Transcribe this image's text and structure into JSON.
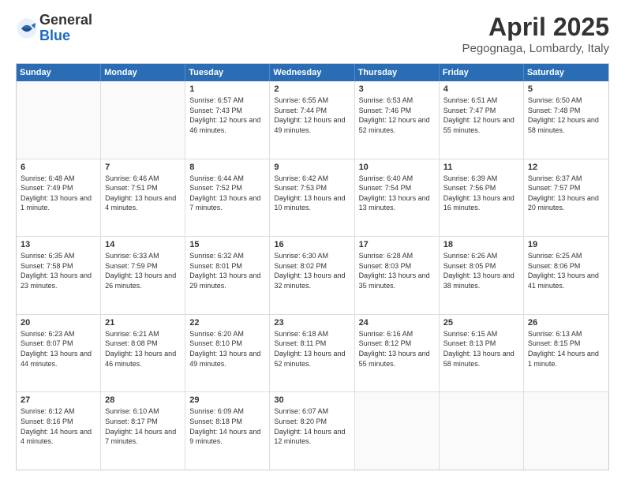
{
  "header": {
    "logo_general": "General",
    "logo_blue": "Blue",
    "title": "April 2025",
    "location": "Pegognaga, Lombardy, Italy"
  },
  "weekdays": [
    "Sunday",
    "Monday",
    "Tuesday",
    "Wednesday",
    "Thursday",
    "Friday",
    "Saturday"
  ],
  "rows": [
    [
      {
        "day": "",
        "detail": ""
      },
      {
        "day": "",
        "detail": ""
      },
      {
        "day": "1",
        "detail": "Sunrise: 6:57 AM\nSunset: 7:43 PM\nDaylight: 12 hours\nand 46 minutes."
      },
      {
        "day": "2",
        "detail": "Sunrise: 6:55 AM\nSunset: 7:44 PM\nDaylight: 12 hours\nand 49 minutes."
      },
      {
        "day": "3",
        "detail": "Sunrise: 6:53 AM\nSunset: 7:46 PM\nDaylight: 12 hours\nand 52 minutes."
      },
      {
        "day": "4",
        "detail": "Sunrise: 6:51 AM\nSunset: 7:47 PM\nDaylight: 12 hours\nand 55 minutes."
      },
      {
        "day": "5",
        "detail": "Sunrise: 6:50 AM\nSunset: 7:48 PM\nDaylight: 12 hours\nand 58 minutes."
      }
    ],
    [
      {
        "day": "6",
        "detail": "Sunrise: 6:48 AM\nSunset: 7:49 PM\nDaylight: 13 hours\nand 1 minute."
      },
      {
        "day": "7",
        "detail": "Sunrise: 6:46 AM\nSunset: 7:51 PM\nDaylight: 13 hours\nand 4 minutes."
      },
      {
        "day": "8",
        "detail": "Sunrise: 6:44 AM\nSunset: 7:52 PM\nDaylight: 13 hours\nand 7 minutes."
      },
      {
        "day": "9",
        "detail": "Sunrise: 6:42 AM\nSunset: 7:53 PM\nDaylight: 13 hours\nand 10 minutes."
      },
      {
        "day": "10",
        "detail": "Sunrise: 6:40 AM\nSunset: 7:54 PM\nDaylight: 13 hours\nand 13 minutes."
      },
      {
        "day": "11",
        "detail": "Sunrise: 6:39 AM\nSunset: 7:56 PM\nDaylight: 13 hours\nand 16 minutes."
      },
      {
        "day": "12",
        "detail": "Sunrise: 6:37 AM\nSunset: 7:57 PM\nDaylight: 13 hours\nand 20 minutes."
      }
    ],
    [
      {
        "day": "13",
        "detail": "Sunrise: 6:35 AM\nSunset: 7:58 PM\nDaylight: 13 hours\nand 23 minutes."
      },
      {
        "day": "14",
        "detail": "Sunrise: 6:33 AM\nSunset: 7:59 PM\nDaylight: 13 hours\nand 26 minutes."
      },
      {
        "day": "15",
        "detail": "Sunrise: 6:32 AM\nSunset: 8:01 PM\nDaylight: 13 hours\nand 29 minutes."
      },
      {
        "day": "16",
        "detail": "Sunrise: 6:30 AM\nSunset: 8:02 PM\nDaylight: 13 hours\nand 32 minutes."
      },
      {
        "day": "17",
        "detail": "Sunrise: 6:28 AM\nSunset: 8:03 PM\nDaylight: 13 hours\nand 35 minutes."
      },
      {
        "day": "18",
        "detail": "Sunrise: 6:26 AM\nSunset: 8:05 PM\nDaylight: 13 hours\nand 38 minutes."
      },
      {
        "day": "19",
        "detail": "Sunrise: 6:25 AM\nSunset: 8:06 PM\nDaylight: 13 hours\nand 41 minutes."
      }
    ],
    [
      {
        "day": "20",
        "detail": "Sunrise: 6:23 AM\nSunset: 8:07 PM\nDaylight: 13 hours\nand 44 minutes."
      },
      {
        "day": "21",
        "detail": "Sunrise: 6:21 AM\nSunset: 8:08 PM\nDaylight: 13 hours\nand 46 minutes."
      },
      {
        "day": "22",
        "detail": "Sunrise: 6:20 AM\nSunset: 8:10 PM\nDaylight: 13 hours\nand 49 minutes."
      },
      {
        "day": "23",
        "detail": "Sunrise: 6:18 AM\nSunset: 8:11 PM\nDaylight: 13 hours\nand 52 minutes."
      },
      {
        "day": "24",
        "detail": "Sunrise: 6:16 AM\nSunset: 8:12 PM\nDaylight: 13 hours\nand 55 minutes."
      },
      {
        "day": "25",
        "detail": "Sunrise: 6:15 AM\nSunset: 8:13 PM\nDaylight: 13 hours\nand 58 minutes."
      },
      {
        "day": "26",
        "detail": "Sunrise: 6:13 AM\nSunset: 8:15 PM\nDaylight: 14 hours\nand 1 minute."
      }
    ],
    [
      {
        "day": "27",
        "detail": "Sunrise: 6:12 AM\nSunset: 8:16 PM\nDaylight: 14 hours\nand 4 minutes."
      },
      {
        "day": "28",
        "detail": "Sunrise: 6:10 AM\nSunset: 8:17 PM\nDaylight: 14 hours\nand 7 minutes."
      },
      {
        "day": "29",
        "detail": "Sunrise: 6:09 AM\nSunset: 8:18 PM\nDaylight: 14 hours\nand 9 minutes."
      },
      {
        "day": "30",
        "detail": "Sunrise: 6:07 AM\nSunset: 8:20 PM\nDaylight: 14 hours\nand 12 minutes."
      },
      {
        "day": "",
        "detail": ""
      },
      {
        "day": "",
        "detail": ""
      },
      {
        "day": "",
        "detail": ""
      }
    ]
  ]
}
